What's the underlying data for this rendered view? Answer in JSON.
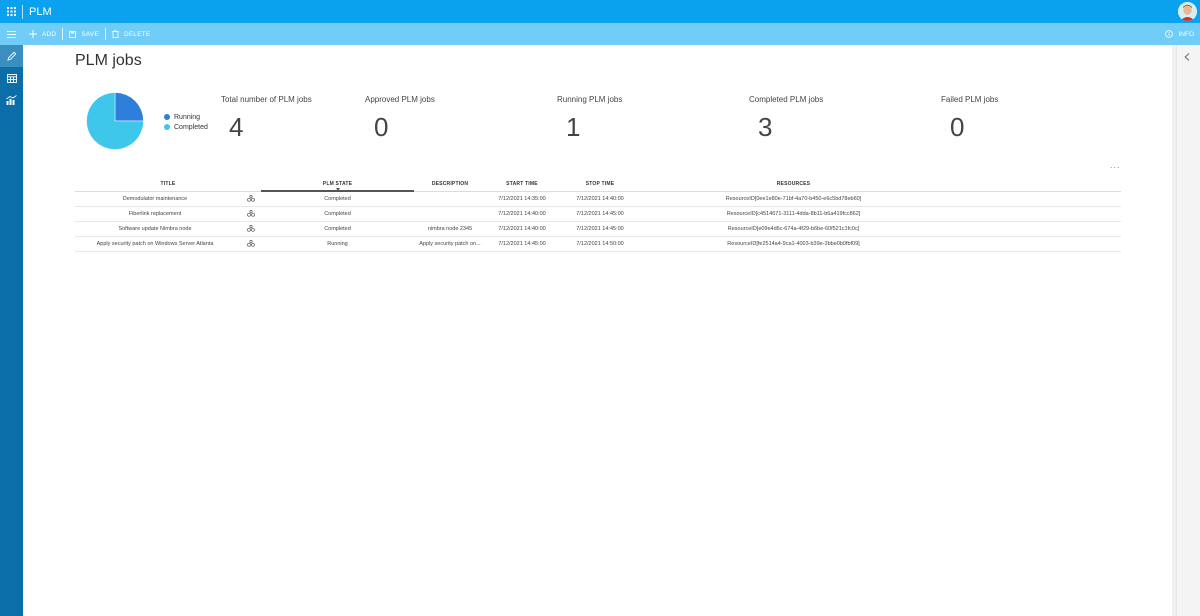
{
  "app": {
    "title": "PLM"
  },
  "toolbar": {
    "add_label": "ADD",
    "save_label": "SAVE",
    "delete_label": "DELETE",
    "info_label": "INFO"
  },
  "page": {
    "title": "PLM jobs"
  },
  "colors": {
    "topbar": "#0aa2ef",
    "toolbar": "#6fcdf8",
    "rail": "#0b6ea8",
    "running": "#2d7fdb",
    "completed": "#3ec6eb"
  },
  "legend": [
    {
      "label": "Running",
      "color": "#2d7fdb"
    },
    {
      "label": "Completed",
      "color": "#3ec6eb"
    }
  ],
  "chart_data": {
    "type": "pie",
    "labels": [
      "Running",
      "Completed"
    ],
    "values": [
      1,
      3
    ],
    "colors": [
      "#2d7fdb",
      "#3ec6eb"
    ]
  },
  "stats": [
    {
      "label": "Total number of PLM jobs",
      "value": "4"
    },
    {
      "label": "Approved PLM jobs",
      "value": "0"
    },
    {
      "label": "Running PLM jobs",
      "value": "1"
    },
    {
      "label": "Completed PLM jobs",
      "value": "3"
    },
    {
      "label": "Failed PLM jobs",
      "value": "0"
    }
  ],
  "more_label": "...",
  "table": {
    "columns": [
      "TITLE",
      "PLM STATE",
      "DESCRIPTION",
      "START TIME",
      "STOP TIME",
      "RESOURCES"
    ],
    "rows": [
      {
        "title": "Demodulator maintenance",
        "state": "Completed",
        "description": "",
        "start": "7/12/2021 14:35:00",
        "stop": "7/12/2021 14:40:00",
        "resources": "ResourceID[0ee1e80e-71bf-4a70-b450-e6c5bd78eb60]"
      },
      {
        "title": "Fiberlink replacement",
        "state": "Completed",
        "description": "",
        "start": "7/12/2021 14:40:00",
        "stop": "7/12/2021 14:45:00",
        "resources": "ResourceID[c4514671-3111-4dda-8b11-b6a419fcc862]"
      },
      {
        "title": "Software update Nimbra node",
        "state": "Completed",
        "description": "nimbra node 2345",
        "start": "7/12/2021 14:40:00",
        "stop": "7/12/2021 14:45:00",
        "resources": "ResourceID[e09e4d6c-674a-4f29-b6be-60f521c1fc0c]"
      },
      {
        "title": "Apply security patch on Windows Server Atlanta",
        "state": "Running",
        "description": "Apply security patch on...",
        "start": "7/12/2021 14:45:00",
        "stop": "7/12/2021 14:50:00",
        "resources": "ResourceID[fe2514a4-9ca1-4003-b39e-3bbe0b0fbf09]"
      }
    ]
  }
}
